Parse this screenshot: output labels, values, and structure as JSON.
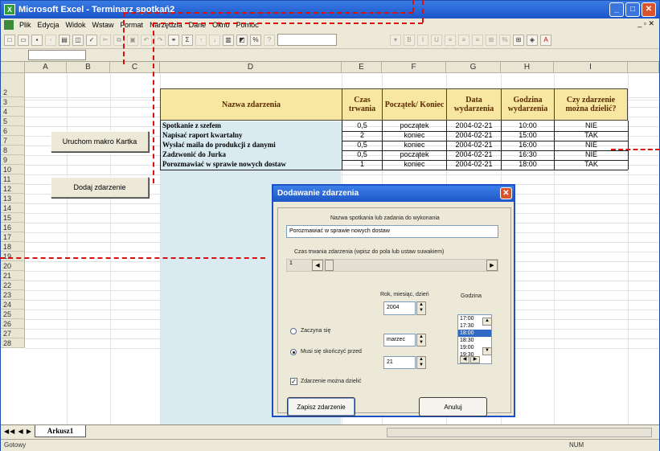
{
  "window": {
    "title": "Microsoft Excel - Terminarz spotkań2"
  },
  "menu": [
    "Plik",
    "Edycja",
    "Widok",
    "Wstaw",
    "Format",
    "Narzędzia",
    "Dane",
    "Okno",
    "Pomoc"
  ],
  "columns": [
    "A",
    "B",
    "C",
    "D",
    "E",
    "F",
    "G",
    "H",
    "I"
  ],
  "rows": [
    "1",
    "2",
    "3",
    "4",
    "5",
    "6",
    "7",
    "8",
    "9",
    "10",
    "11",
    "12",
    "13",
    "14",
    "15",
    "16",
    "17",
    "18",
    "19",
    "20",
    "21",
    "22",
    "23",
    "24",
    "25",
    "26",
    "27",
    "28"
  ],
  "table": {
    "headers": [
      "Nazwa zdarzenia",
      "Czas trwania",
      "Początek/ Koniec",
      "Data wydarzenia",
      "Godzina wydarzenia",
      "Czy zdarzenie można dzielić?"
    ],
    "rows": [
      [
        "Spotkanie z szefem",
        "0,5",
        "początek",
        "2004-02-21",
        "10:00",
        "NIE"
      ],
      [
        "Napisać raport kwartalny",
        "2",
        "koniec",
        "2004-02-21",
        "15:00",
        "TAK"
      ],
      [
        "Wysłać maila do produkcji z danymi",
        "0,5",
        "koniec",
        "2004-02-21",
        "16:00",
        "NIE"
      ],
      [
        "Zadzwonić do Jurka",
        "0,5",
        "początek",
        "2004-02-21",
        "16:30",
        "NIE"
      ],
      [
        "Porozmawiać w sprawie nowych dostaw",
        "1",
        "koniec",
        "2004-02-21",
        "18:00",
        "TAK"
      ]
    ]
  },
  "buttons": {
    "macro": "Uruchom makro Kartka",
    "add_event": "Dodaj zdarzenie"
  },
  "dialog": {
    "title": "Dodawanie zdarzenia",
    "name_label": "Nazwa spotkania lub zadania do wykonania",
    "name_value": "Porozmawiać w sprawie nowych dostaw",
    "duration_label": "Czas trwania zdarzenia (wpisz do pola lub ustaw suwakiem)",
    "duration_value": "1",
    "date_label": "Rok, miesiąc, dzień",
    "year": "2004",
    "month": "marzec",
    "day": "21",
    "hour_label": "Godzina",
    "hours": [
      "17:00",
      "17:30",
      "18:00",
      "18:30",
      "19:00",
      "19:30"
    ],
    "selected_hour_index": 2,
    "radio_start": "Zaczyna się",
    "radio_end": "Musi się skończyć przed",
    "radio_selected": "end",
    "checkbox_label": "Zdarzenie można dzielić",
    "checkbox_checked": true,
    "save_button": "Zapisz zdarzenie",
    "cancel_button": "Anuluj"
  },
  "sheet_tab": "Arkusz1",
  "status": {
    "left": "Gotowy",
    "num": "NUM"
  }
}
